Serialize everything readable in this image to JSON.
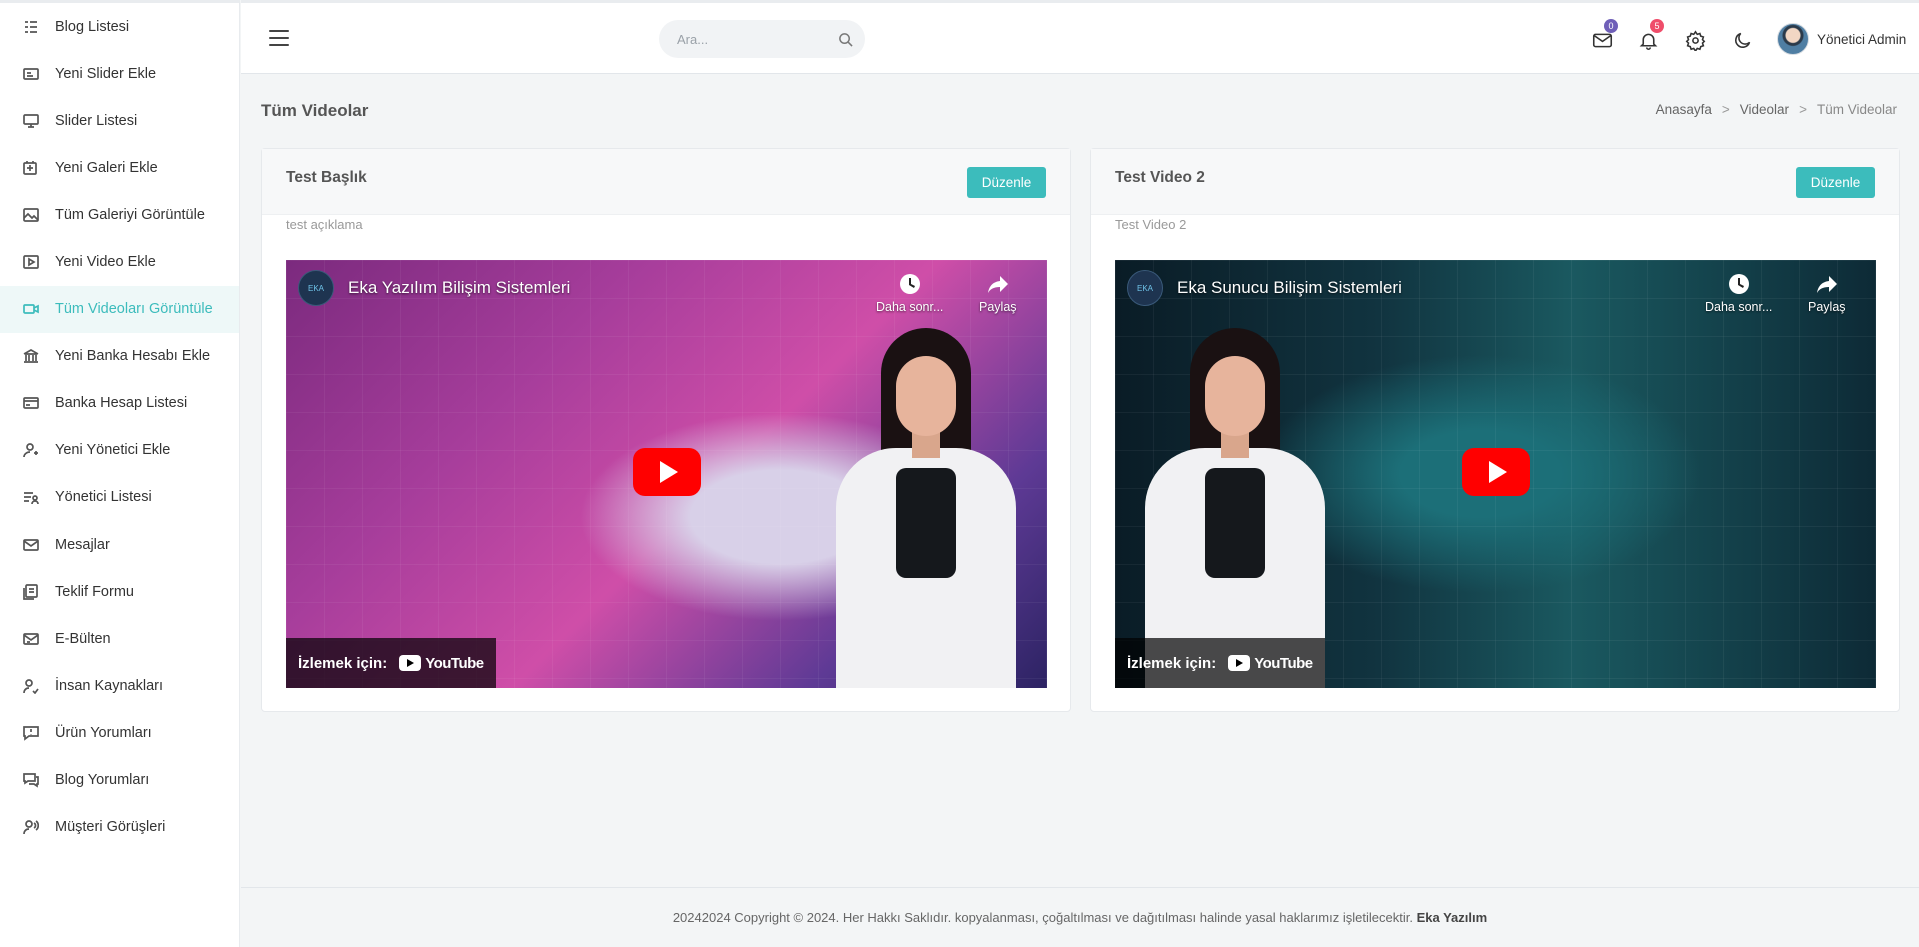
{
  "sidebar": {
    "items": [
      {
        "label": "Blog Listesi",
        "icon": "list-icon"
      },
      {
        "label": "Yeni Slider Ekle",
        "icon": "slider-add-icon"
      },
      {
        "label": "Slider Listesi",
        "icon": "monitor-icon"
      },
      {
        "label": "Yeni Galeri Ekle",
        "icon": "gallery-add-icon"
      },
      {
        "label": "Tüm Galeriyi Görüntüle",
        "icon": "image-icon"
      },
      {
        "label": "Yeni Video Ekle",
        "icon": "video-add-icon"
      },
      {
        "label": "Tüm Videoları Görüntüle",
        "icon": "video-camera-icon"
      },
      {
        "label": "Yeni Banka Hesabı Ekle",
        "icon": "bank-icon"
      },
      {
        "label": "Banka Hesap Listesi",
        "icon": "credit-card-icon"
      },
      {
        "label": "Yeni Yönetici Ekle",
        "icon": "user-add-icon"
      },
      {
        "label": "Yönetici Listesi",
        "icon": "user-list-icon"
      },
      {
        "label": "Mesajlar",
        "icon": "mail-icon"
      },
      {
        "label": "Teklif Formu",
        "icon": "form-icon"
      },
      {
        "label": "E-Bülten",
        "icon": "newsletter-icon"
      },
      {
        "label": "İnsan Kaynakları",
        "icon": "hr-icon"
      },
      {
        "label": "Ürün Yorumları",
        "icon": "comment-icon"
      },
      {
        "label": "Blog Yorumları",
        "icon": "comments-icon"
      },
      {
        "label": "Müşteri Görüşleri",
        "icon": "testimonial-icon"
      }
    ],
    "active_index": 6
  },
  "header": {
    "search_placeholder": "Ara...",
    "mail_badge": "0",
    "notification_badge": "5",
    "admin_name": "Yönetici Admin"
  },
  "page": {
    "title": "Tüm Videolar",
    "breadcrumb": [
      "Anasayfa",
      "Videolar",
      "Tüm Videolar"
    ]
  },
  "videos": [
    {
      "title": "Test Başlık",
      "description": "test açıklama",
      "edit_label": "Düzenle",
      "channel": "Eka Yazılım Bilişim Sistemleri",
      "watch_later": "Daha sonr...",
      "share": "Paylaş",
      "watch_on": "İzlemek için:",
      "youtube": "YouTube"
    },
    {
      "title": "Test Video 2",
      "description": "Test Video 2",
      "edit_label": "Düzenle",
      "channel": "Eka Sunucu Bilişim Sistemleri",
      "watch_later": "Daha sonr...",
      "share": "Paylaş",
      "watch_on": "İzlemek için:",
      "youtube": "YouTube"
    }
  ],
  "footer": {
    "text": "20242024 Copyright © 2024. Her Hakkı Saklıdır. kopyalanması, çoğaltılması ve dağıtılması halinde yasal haklarımız işletilecektir.",
    "brand": "Eka Yazılım"
  },
  "colors": {
    "accent": "#3cbcbc",
    "mail_badge": "#6f5fb8",
    "notification_badge": "#ef4d6a"
  }
}
